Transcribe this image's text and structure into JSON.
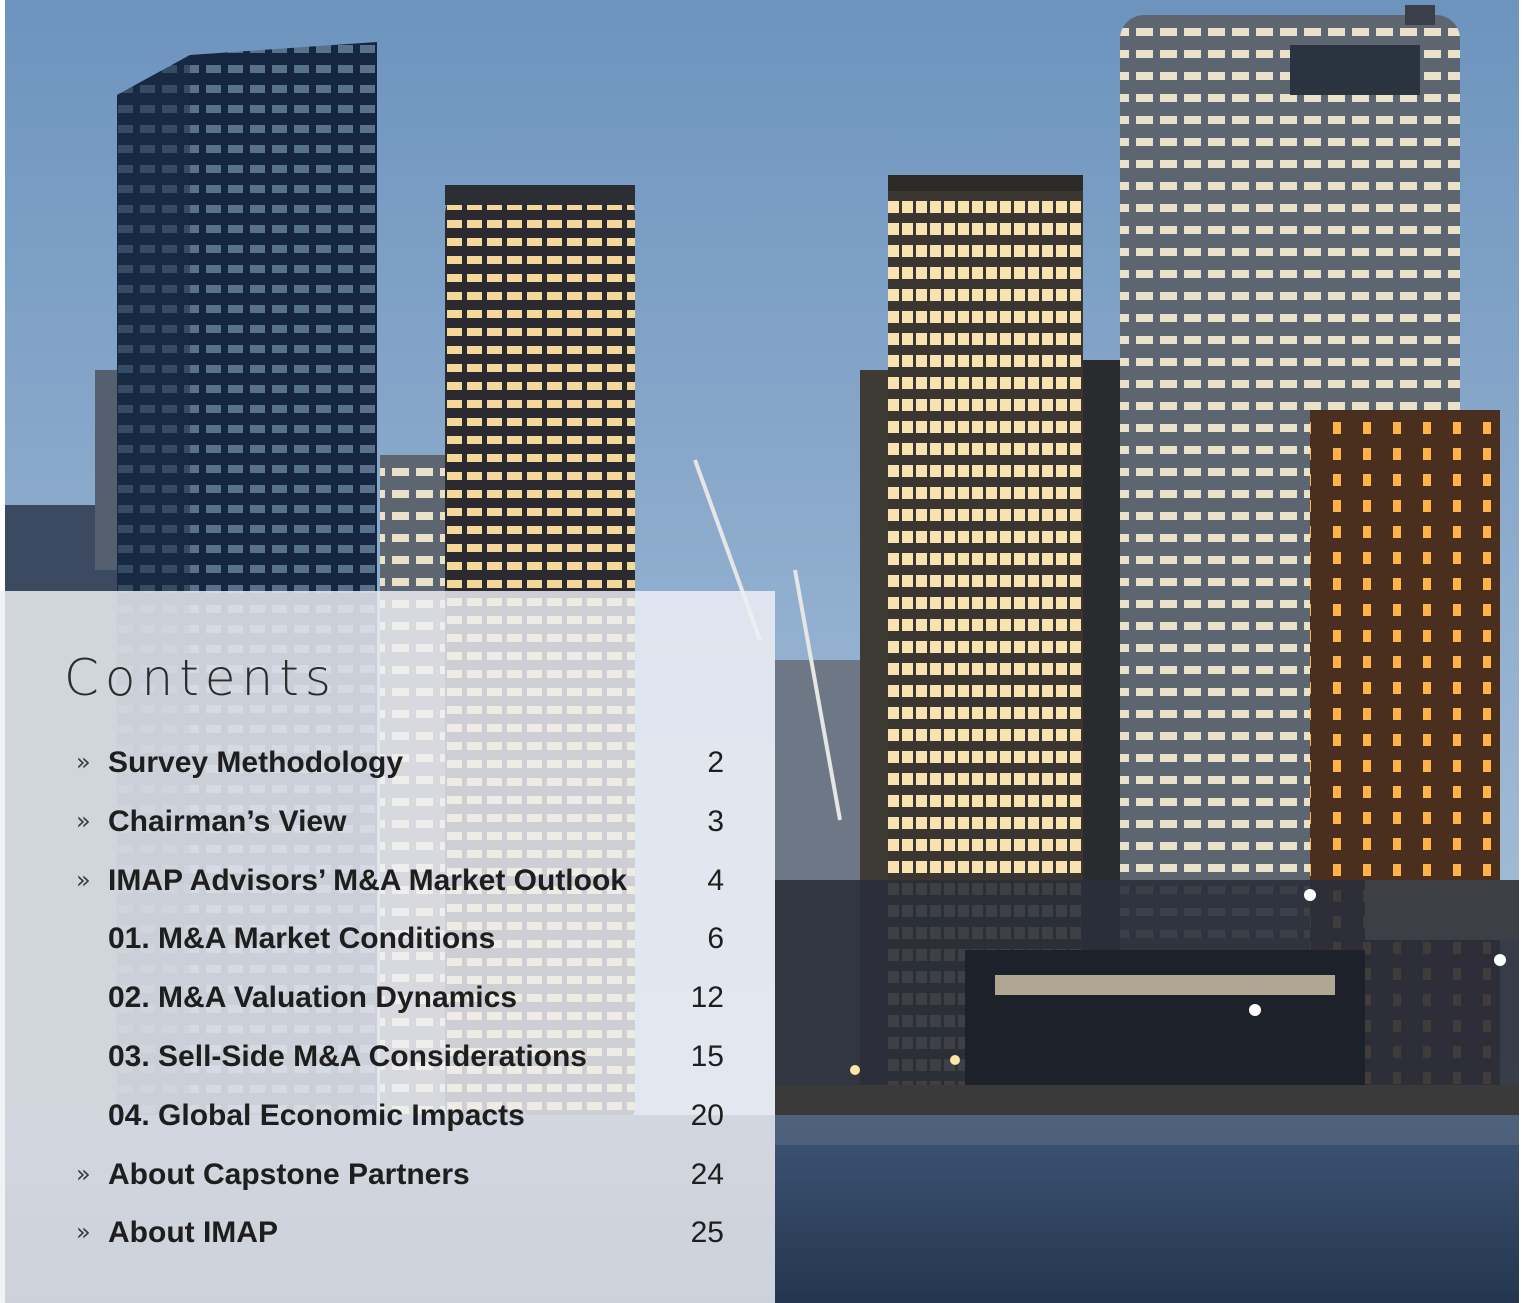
{
  "contents": {
    "title": "Contents",
    "arrow_glyph": "»",
    "items": [
      {
        "label": "Survey Methodology",
        "page": "2",
        "has_arrow": true
      },
      {
        "label": "Chairman’s View",
        "page": "3",
        "has_arrow": true
      },
      {
        "label": "IMAP Advisors’ M&A Market Outlook",
        "page": "4",
        "has_arrow": true
      },
      {
        "label": "01. M&A Market Conditions",
        "page": "6",
        "has_arrow": false
      },
      {
        "label": "02. M&A Valuation Dynamics",
        "page": "12",
        "has_arrow": false
      },
      {
        "label": "03. Sell-Side M&A Considerations",
        "page": "15",
        "has_arrow": false
      },
      {
        "label": "04. Global Economic Impacts",
        "page": "20",
        "has_arrow": false
      },
      {
        "label": "About Capstone Partners",
        "page": "24",
        "has_arrow": true
      },
      {
        "label": "About IMAP",
        "page": "25",
        "has_arrow": true
      }
    ]
  },
  "colors": {
    "sky_top": "#6f96bf",
    "sky_bottom": "#a9c0d8",
    "water": "#2d4260",
    "panel": "#eef0f4",
    "text": "#1e1e1e"
  }
}
